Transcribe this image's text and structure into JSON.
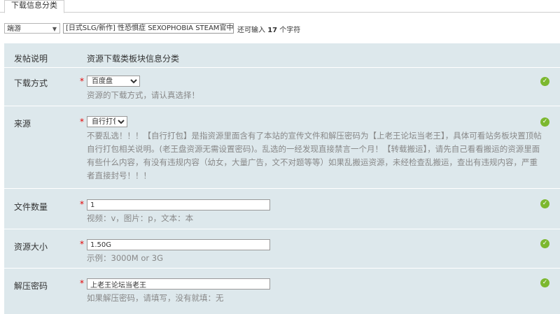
{
  "tab": {
    "label": "下载信息分类"
  },
  "topbar": {
    "category_select": "端游",
    "title_value": "[日式SLG/新作] 性恐惧症 SEXOPHOBIA STEAM官中步兵",
    "remain_prefix": "还可输入",
    "remain_count": "17",
    "remain_suffix": "个字符"
  },
  "form": {
    "header": {
      "label": "发帖说明",
      "value": "资源下载类板块信息分类"
    },
    "download_method": {
      "label": "下载方式",
      "selected": "百度盘",
      "desc": "资源的下载方式，请认真选择！"
    },
    "source": {
      "label": "来源",
      "selected": "自行打包",
      "desc": "不要乱选！！！【自行打包】是指资源里面含有了本站的宣传文件和解压密码为【上老王论坛当老王】，具体可看站务板块置顶帖自行打包相关说明。(老王盘资源无需设置密码)。乱选的一经发现直接禁言一个月！【转载搬运】，请先自己看看搬运的资源里面有些什么内容，有没有违规内容（幼女，大量广告，文不对题等等）如果乱搬运资源，未经检查乱搬运，查出有违规内容，严重者直接封号！！！"
    },
    "file_count": {
      "label": "文件数量",
      "value": "1",
      "desc": "视频：v，图片：p，文本：本"
    },
    "size": {
      "label": "资源大小",
      "value": "1.50G",
      "desc": "示例：3000M or 3G"
    },
    "password": {
      "label": "解压密码",
      "value": "上老王论坛当老王",
      "desc": "如果解压密码，请填写，没有就填：无"
    }
  },
  "required_mark": "*",
  "ok_glyph": "✓"
}
